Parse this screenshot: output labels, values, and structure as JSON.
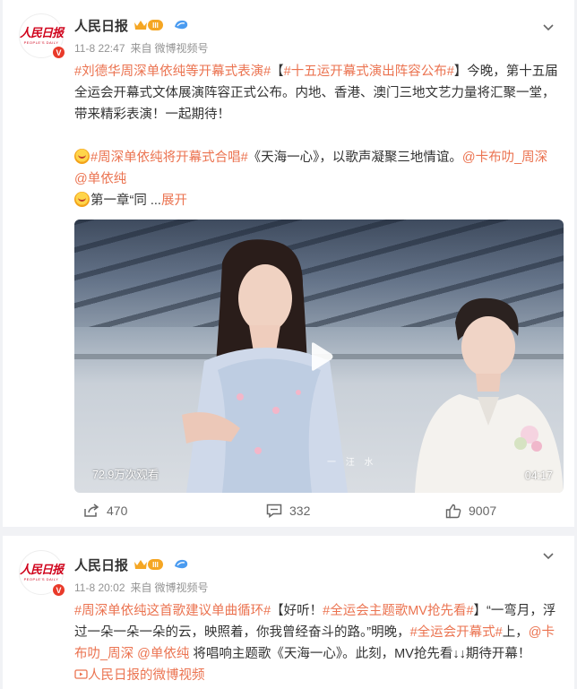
{
  "posts": [
    {
      "author": "人民日报",
      "avatar_text": "人民日报",
      "avatar_sub": "PEOPLE'S DAILY",
      "verified_badge": "V",
      "level": "III",
      "time": "11-8 22:47",
      "source_prefix": "来自",
      "source": "微博视频号",
      "line1": {
        "tag1": "#刘德华周深单依纯等开幕式表演#",
        "bracket_open": "【",
        "tag2": "#十五运开幕式演出阵容公布#",
        "bracket_close": "】",
        "text": "今晚，第十五届全运会开幕式文体展演阵容正式公布。内地、香港、澳门三地文艺力量将汇聚一堂，带来精彩表演！一起期待！"
      },
      "line2": {
        "tag": "#周深单依纯将开幕式合唱#",
        "text": "《天海一心》，以歌声凝聚三地情谊。",
        "mention1": "@卡布叻_周深",
        "mention2": "@单依纯"
      },
      "line3": {
        "text": "第一章“同 ...",
        "expand": "展开"
      },
      "video": {
        "views": "72.9万次观看",
        "duration": "04:17",
        "subtitle": "一 汪 水"
      },
      "actions": {
        "repost": "470",
        "comment": "332",
        "like": "9007"
      }
    },
    {
      "author": "人民日报",
      "avatar_text": "人民日报",
      "avatar_sub": "PEOPLE'S DAILY",
      "verified_badge": "V",
      "level": "III",
      "time": "11-8 20:02",
      "source_prefix": "来自",
      "source": "微博视频号",
      "text": {
        "tag1": "#周深单依纯这首歌建议单曲循环#",
        "p1": "【好听！",
        "tag2": "#全运会主题歌MV抢先看#",
        "p2": "】“一弯月，浮过一朵一朵一朵的云，映照着，你我曾经奋斗的路。”明晚，",
        "tag3": "#全运会开幕式#",
        "p3": "上，",
        "mention1": "@卡布叻_周深",
        "mention2": "@单依纯",
        "p4": " 将唱响主题歌《天海一心》。此刻，MV抢先看↓↓期待开幕！",
        "video_link": "人民日报的微博视频"
      }
    }
  ],
  "colors": {
    "accent": "#eb7350",
    "text": "#333333",
    "meta": "#939393",
    "background": "#f1f2f5",
    "verified": "#e93a2a",
    "logo": "#d0021b"
  }
}
